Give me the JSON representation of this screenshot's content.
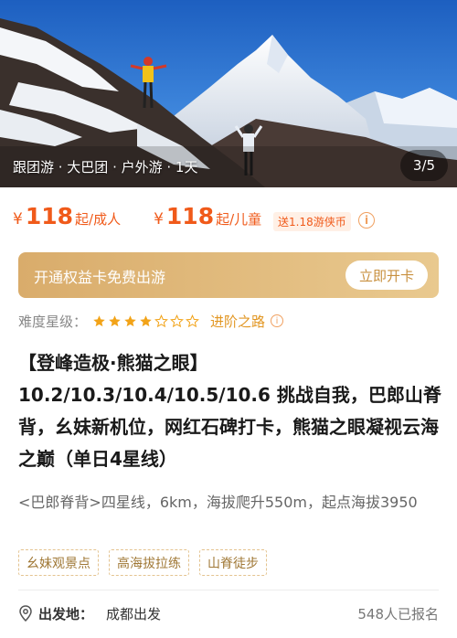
{
  "hero": {
    "caption": "跟团游 · 大巴团 · 户外游 · 1天",
    "counter": "3/5"
  },
  "pricing": {
    "adult": {
      "currency": "¥",
      "amount": "118",
      "unit": "起/成人"
    },
    "child": {
      "currency": "¥",
      "amount": "118",
      "unit": "起/儿童"
    },
    "promo": "送1.18游侠币",
    "accent_color": "#f05a1a"
  },
  "banner": {
    "text": "开通权益卡免费出游",
    "button": "立即开卡"
  },
  "difficulty": {
    "label": "难度星级：",
    "rating": 4,
    "max": 7,
    "link": "进阶之路"
  },
  "product": {
    "title_line1": "【登峰造极·熊猫之眼】",
    "title_rest": "10.2/10.3/10.4/10.5/10.6 挑战自我，巴郎山脊背，幺妹新机位，网红石碑打卡，熊猫之眼凝视云海之巅（单日4星线）",
    "description": "<巴郎脊背>四星线，6km，海拔爬升550m，起点海拔3950"
  },
  "tags": [
    "幺妹观景点",
    "高海拔拉练",
    "山脊徒步"
  ],
  "departure": {
    "label": "出发地：",
    "value": "成都出发",
    "signed_up": "548人已报名"
  }
}
